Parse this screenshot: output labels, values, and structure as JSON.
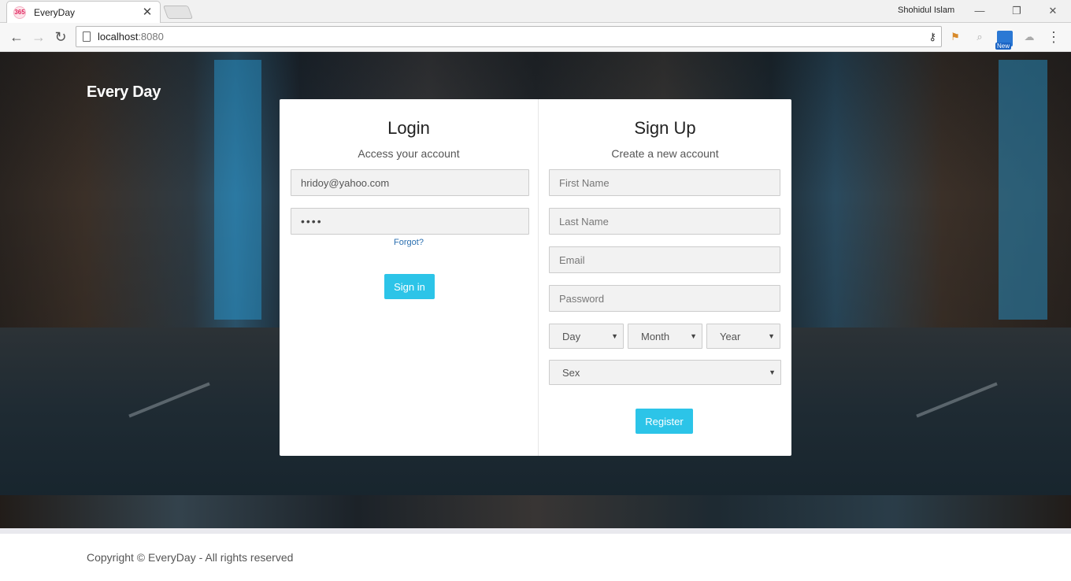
{
  "browser": {
    "tab_title": "EveryDay",
    "favicon_text": "365",
    "tab_close": "✕",
    "profile_name": "Shohidul Islam",
    "window_minimize": "—",
    "window_restore": "❐",
    "window_close": "✕",
    "url_host": "localhost",
    "url_port": ":8080",
    "back": "←",
    "forward": "→",
    "reload": "↻",
    "menu": "⋮",
    "ext_new_label": "New"
  },
  "site": {
    "brand": "Every Day",
    "copyright": "Copyright © EveryDay - All rights reserved"
  },
  "login": {
    "title": "Login",
    "subtitle": "Access your account",
    "email_value": "hridoy@yahoo.com",
    "password_value": "••••",
    "forgot_link": "Forgot?",
    "signin_button": "Sign in"
  },
  "signup": {
    "title": "Sign Up",
    "subtitle": "Create a new account",
    "first_name_placeholder": "First Name",
    "last_name_placeholder": "Last Name",
    "email_placeholder": "Email",
    "password_placeholder": "Password",
    "day_select": "Day",
    "month_select": "Month",
    "year_select": "Year",
    "sex_select": "Sex",
    "register_button": "Register"
  },
  "colors": {
    "accent": "#2cc4e8",
    "link": "#2a6fb0"
  }
}
